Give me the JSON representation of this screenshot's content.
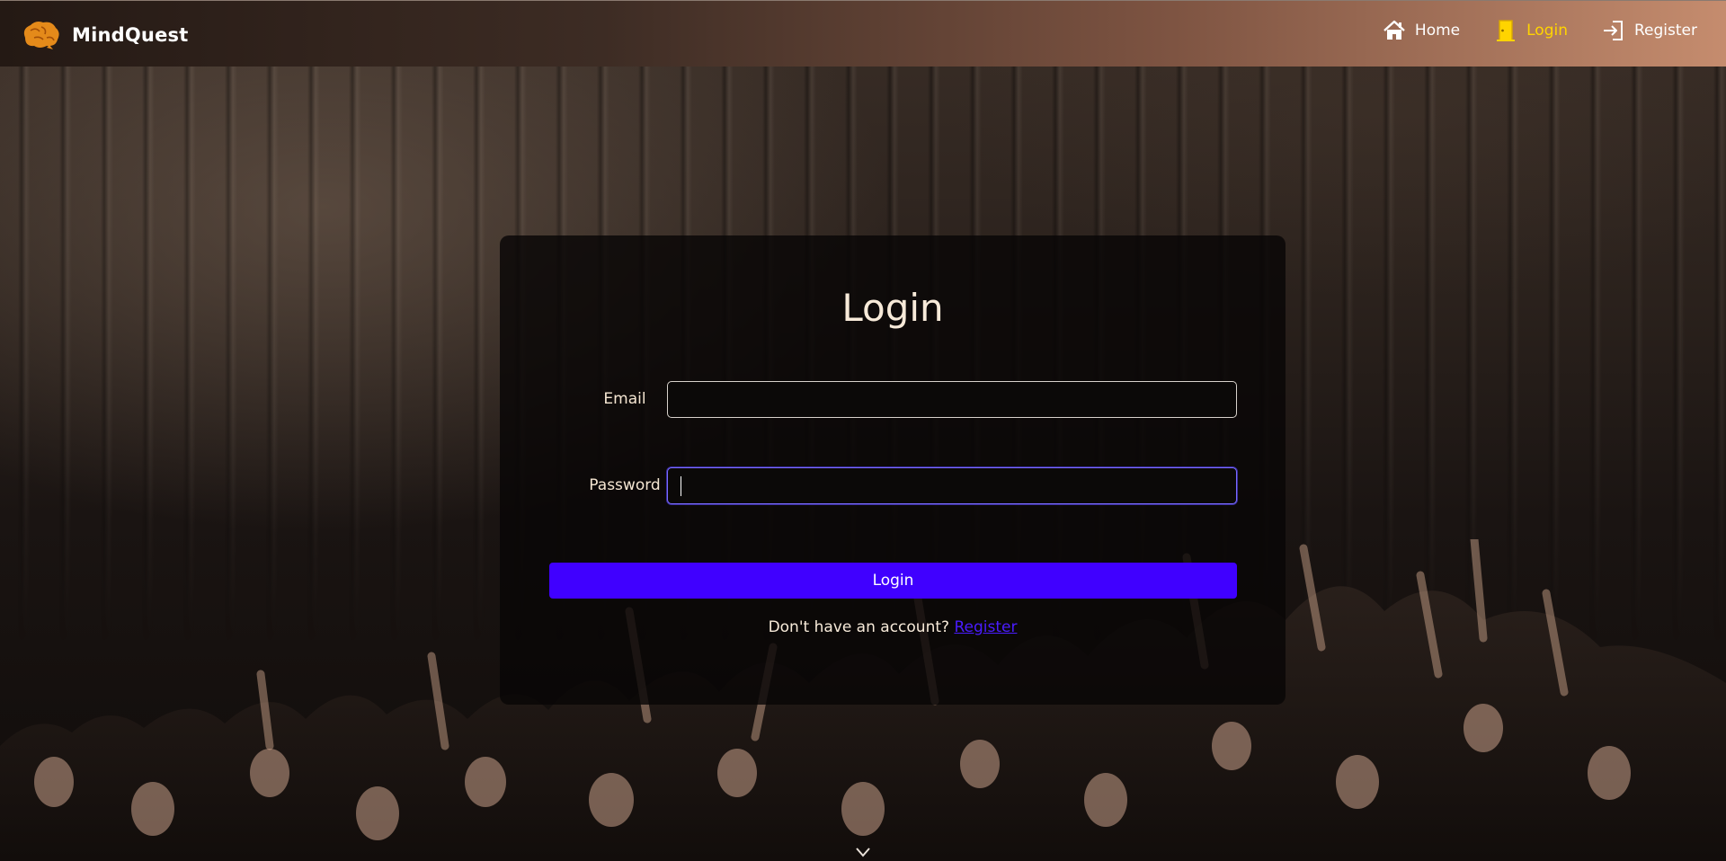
{
  "brand": {
    "name": "MindQuest",
    "logo_icon": "brain-icon"
  },
  "nav": {
    "items": [
      {
        "label": "Home",
        "icon": "home-icon",
        "active": false
      },
      {
        "label": "Login",
        "icon": "door-icon",
        "active": true
      },
      {
        "label": "Register",
        "icon": "sign-in-icon",
        "active": false
      }
    ]
  },
  "login_card": {
    "title": "Login",
    "email_label": "Email",
    "email_value": "",
    "password_label": "Password",
    "password_value": "",
    "submit_label": "Login",
    "register_prompt": "Don't have an account?",
    "register_link": "Register"
  },
  "colors": {
    "accent": "#4000ff",
    "active_nav": "#ffd400",
    "focus_border": "#7a6cff"
  }
}
